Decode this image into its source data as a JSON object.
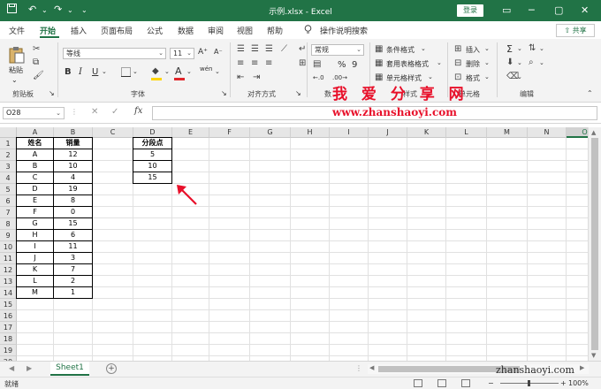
{
  "window": {
    "title": "示例.xlsx - Excel",
    "login_label": "登录",
    "controls": [
      "▭",
      "─",
      "▢",
      "✕"
    ]
  },
  "quick_access": {
    "save_icon": "save-icon",
    "undo": "↶",
    "redo": "↷",
    "more": "⌄"
  },
  "tabs": {
    "items": [
      {
        "label": "文件"
      },
      {
        "label": "开始"
      },
      {
        "label": "插入"
      },
      {
        "label": "页面布局"
      },
      {
        "label": "公式"
      },
      {
        "label": "数据"
      },
      {
        "label": "审阅"
      },
      {
        "label": "视图"
      },
      {
        "label": "帮助"
      }
    ],
    "active": "开始",
    "search_label": "操作说明搜索",
    "share_label": "共享"
  },
  "ribbon": {
    "clipboard": {
      "paste_label": "粘贴",
      "group_label": "剪贴板"
    },
    "font": {
      "font_name": "等线",
      "font_size": "11",
      "group_label": "字体",
      "bold": "B",
      "italic": "I",
      "underline": "U",
      "grow": "A⁺",
      "shrink": "A⁻",
      "wen": "wén",
      "font_color_letter": "A"
    },
    "alignment": {
      "group_label": "对齐方式"
    },
    "number": {
      "format": "常规",
      "group_label": "数",
      "percent": "%",
      "comma": "9"
    },
    "styles": {
      "conditional": "条件格式",
      "table_format": "套用表格格式",
      "cell_style": "单元格样式",
      "group_label": "样式"
    },
    "cells": {
      "insert": "插入",
      "delete": "删除",
      "format": "格式",
      "group_label": "单元格"
    },
    "editing": {
      "group_label": "编辑",
      "sum": "Σ"
    },
    "colors": {
      "accent": "#217346",
      "fill": "#ffd400",
      "font_color": "#e0252b"
    }
  },
  "watermark": {
    "cn": "我 爱 分 享 网",
    "url": "www.zhanshaoyi.com",
    "corner": "zhanshaoyi.com"
  },
  "formula_bar": {
    "name_box": "O28",
    "fx": "fx",
    "cancel": "✕",
    "enter": "✓",
    "value": ""
  },
  "grid": {
    "columns": [
      "A",
      "B",
      "C",
      "D",
      "E",
      "F",
      "G",
      "H",
      "I",
      "J",
      "K",
      "L",
      "M",
      "N",
      "O"
    ],
    "selected_column": "O",
    "rows": [
      "1",
      "2",
      "3",
      "4",
      "5",
      "6",
      "7",
      "8",
      "9",
      "10",
      "11",
      "12",
      "13",
      "14",
      "15",
      "16",
      "17",
      "18",
      "19",
      "20"
    ],
    "table1": {
      "headers": [
        "姓名",
        "销量"
      ],
      "rows": [
        [
          "A",
          "12"
        ],
        [
          "B",
          "10"
        ],
        [
          "C",
          "4"
        ],
        [
          "D",
          "19"
        ],
        [
          "E",
          "8"
        ],
        [
          "F",
          "0"
        ],
        [
          "G",
          "15"
        ],
        [
          "H",
          "6"
        ],
        [
          "I",
          "11"
        ],
        [
          "J",
          "3"
        ],
        [
          "K",
          "7"
        ],
        [
          "L",
          "2"
        ],
        [
          "M",
          "1"
        ]
      ]
    },
    "table2": {
      "header": "分段点",
      "values": [
        "5",
        "10",
        "15"
      ]
    }
  },
  "sheets": {
    "tabs": [
      "Sheet1"
    ],
    "add": "+",
    "nav_prev": "◀",
    "nav_next": "▶"
  },
  "status": {
    "ready": "就绪",
    "zoom": "100%"
  }
}
